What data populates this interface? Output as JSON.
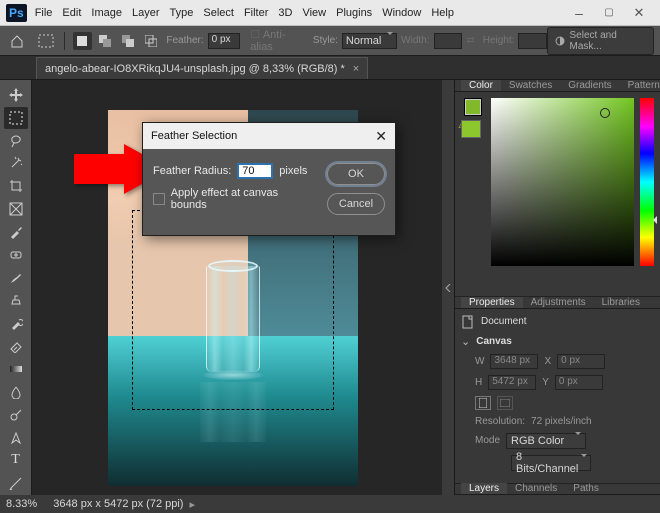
{
  "menu": [
    "File",
    "Edit",
    "Image",
    "Layer",
    "Type",
    "Select",
    "Filter",
    "3D",
    "View",
    "Plugins",
    "Window",
    "Help"
  ],
  "options": {
    "feather_label": "Feather:",
    "feather_value": "0 px",
    "antialias": "Anti-alias",
    "style_label": "Style:",
    "style_value": "Normal",
    "width_label": "Width:",
    "height_label": "Height:",
    "select_mask": "Select and Mask..."
  },
  "tab_title": "angelo-abear-IO8XRikqJU4-unsplash.jpg @ 8,33% (RGB/8) *",
  "dialog": {
    "title": "Feather Selection",
    "radius_label": "Feather Radius:",
    "radius_value": "70",
    "unit": "pixels",
    "apply_bounds": "Apply effect at canvas bounds",
    "ok": "OK",
    "cancel": "Cancel"
  },
  "panels": {
    "color_tabs": [
      "Color",
      "Swatches",
      "Gradients",
      "Patterns"
    ],
    "props_tabs": [
      "Properties",
      "Adjustments",
      "Libraries"
    ],
    "doc_label": "Document",
    "canvas_label": "Canvas",
    "w_label": "W",
    "w_val": "3648 px",
    "x_label": "X",
    "x_val": "0 px",
    "h_label": "H",
    "h_val": "5472 px",
    "y_label": "Y",
    "y_val": "0 px",
    "res_label": "Resolution:",
    "res_val": "72 pixels/inch",
    "mode_label": "Mode",
    "mode_val": "RGB Color",
    "bits_val": "8 Bits/Channel",
    "layers_tabs": [
      "Layers",
      "Channels",
      "Paths"
    ]
  },
  "status": {
    "zoom": "8.33%",
    "dims": "3648 px x 5472 px (72 ppi)"
  }
}
